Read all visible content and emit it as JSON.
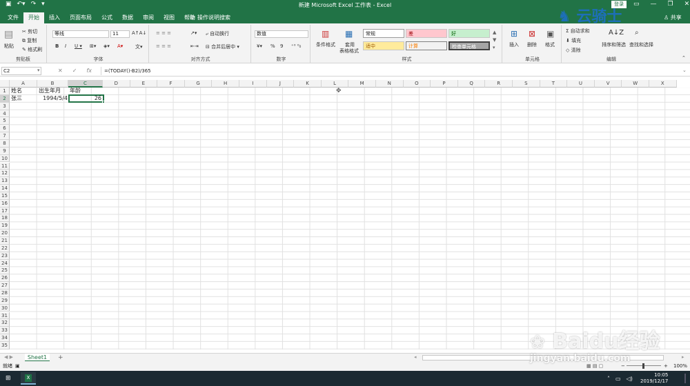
{
  "window": {
    "title": "新建 Microsoft Excel 工作表 - Excel",
    "login": "登录",
    "share": "共享"
  },
  "tabs": [
    "文件",
    "开始",
    "插入",
    "页面布局",
    "公式",
    "数据",
    "审阅",
    "视图",
    "帮助"
  ],
  "tell_me": "操作说明搜索",
  "ribbon": {
    "clipboard": {
      "paste": "粘贴",
      "cut": "剪切",
      "copy": "复制",
      "format_painter": "格式刷",
      "label": "剪贴板"
    },
    "font": {
      "name": "等线",
      "size": "11",
      "label": "字体"
    },
    "alignment": {
      "wrap": "自动换行",
      "merge": "合并后居中",
      "label": "对齐方式"
    },
    "number": {
      "format": "数值",
      "percent": "%",
      "comma": "9",
      "label": "数字"
    },
    "styles": {
      "cond": "条件格式",
      "table1": "套用",
      "table2": "表格格式",
      "normal": "常规",
      "bad": "差",
      "good": "好",
      "neutral": "适中",
      "calc": "计算",
      "check": "检查单元格",
      "label": "样式"
    },
    "cells": {
      "insert": "插入",
      "delete": "删除",
      "format": "格式",
      "label": "单元格"
    },
    "editing": {
      "sum": "自动求和",
      "fill": "填充",
      "clear": "清除",
      "sort": "排序和筛选",
      "find": "查找和选择",
      "label": "编辑"
    }
  },
  "formula_bar": {
    "name_box": "C2",
    "fx": "fx",
    "formula": "=(TODAY()-B2)/365"
  },
  "columns": [
    "A",
    "B",
    "C",
    "D",
    "E",
    "F",
    "G",
    "H",
    "I",
    "J",
    "K",
    "L",
    "M",
    "N",
    "O",
    "P",
    "Q",
    "R",
    "S",
    "T",
    "U",
    "V",
    "W",
    "X"
  ],
  "rows": [
    "1",
    "2",
    "3",
    "4",
    "5",
    "6",
    "7",
    "8",
    "9",
    "10",
    "11",
    "12",
    "13",
    "14",
    "15",
    "16",
    "17",
    "18",
    "19",
    "20",
    "21",
    "22",
    "23",
    "24",
    "25",
    "26",
    "27",
    "28",
    "29",
    "30",
    "31",
    "32",
    "33",
    "34",
    "35"
  ],
  "cells": {
    "A1": "姓名",
    "B1": "出生年月",
    "C1": "年龄",
    "A2": "张三",
    "B2": "1994/5/4",
    "C2": "26"
  },
  "sheet": {
    "name": "Sheet1",
    "add": "+"
  },
  "status": {
    "mode": "就绪",
    "zoom": "100%"
  },
  "taskbar": {
    "time": "10:05",
    "date": "2019/12/17",
    "app": "X"
  },
  "watermarks": {
    "brand": "云骑士",
    "baidu": "Baidu经验",
    "url": "jingyan.baidu.com"
  }
}
